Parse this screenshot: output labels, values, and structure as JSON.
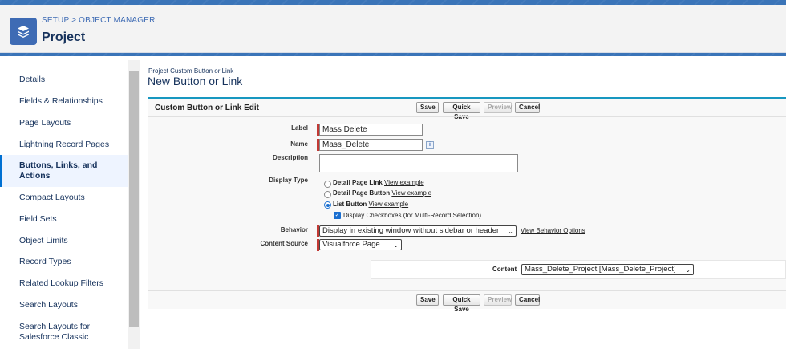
{
  "header": {
    "breadcrumb": "SETUP > OBJECT MANAGER",
    "title": "Project",
    "icon": "layers-icon"
  },
  "sidebar": {
    "items": [
      {
        "label": "Details"
      },
      {
        "label": "Fields & Relationships"
      },
      {
        "label": "Page Layouts"
      },
      {
        "label": "Lightning Record Pages"
      },
      {
        "label": "Buttons, Links, and Actions",
        "active": true
      },
      {
        "label": "Compact Layouts"
      },
      {
        "label": "Field Sets"
      },
      {
        "label": "Object Limits"
      },
      {
        "label": "Record Types"
      },
      {
        "label": "Related Lookup Filters"
      },
      {
        "label": "Search Layouts"
      },
      {
        "label": "Search Layouts for Salesforce Classic"
      }
    ]
  },
  "main": {
    "subtitle": "Project Custom Button or Link",
    "title": "New Button or Link",
    "panel_heading": "Custom Button or Link Edit",
    "buttons": {
      "save": "Save",
      "quick_save": "Quick Save",
      "preview": "Preview",
      "cancel": "Cancel"
    },
    "fields": {
      "label": {
        "label": "Label",
        "value": "Mass Delete"
      },
      "name": {
        "label": "Name",
        "value": "Mass_Delete"
      },
      "description": {
        "label": "Description",
        "value": ""
      },
      "display_type": {
        "label": "Display Type",
        "options": [
          {
            "label": "Detail Page Link",
            "link": "View example",
            "checked": false
          },
          {
            "label": "Detail Page Button",
            "link": "View example",
            "checked": false
          },
          {
            "label": "List Button",
            "link": "View example",
            "checked": true
          }
        ],
        "checkbox_label": "Display Checkboxes (for Multi-Record Selection)",
        "checkbox_checked": true
      },
      "behavior": {
        "label": "Behavior",
        "value": "Display in existing window without sidebar or header",
        "link": "View Behavior Options"
      },
      "content_source": {
        "label": "Content Source",
        "value": "Visualforce Page"
      },
      "content": {
        "label": "Content",
        "value": "Mass_Delete_Project [Mass_Delete_Project]"
      }
    }
  },
  "colors": {
    "header_band": "#3a74b8",
    "accent": "#1797c0",
    "required": "#c23934",
    "active_nav": "#0070d2"
  }
}
